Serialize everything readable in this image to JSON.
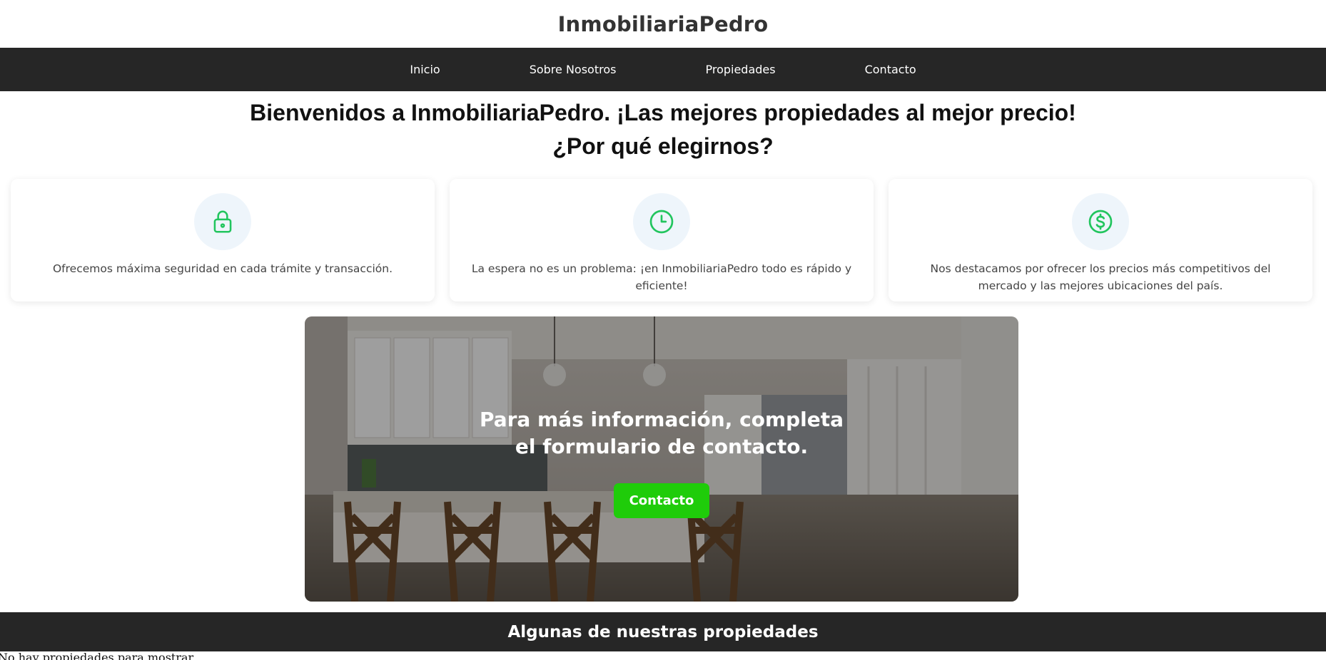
{
  "header": {
    "brand": "InmobiliariaPedro"
  },
  "nav": {
    "items": [
      {
        "label": "Inicio"
      },
      {
        "label": "Sobre Nosotros"
      },
      {
        "label": "Propiedades"
      },
      {
        "label": "Contacto"
      }
    ]
  },
  "hero": {
    "welcome": "Bienvenidos a InmobiliariaPedro. ¡Las mejores propiedades al mejor precio!",
    "why": "¿Por qué elegirnos?"
  },
  "features": [
    {
      "icon": "lock-icon",
      "text": "Ofrecemos máxima seguridad en cada trámite y transacción."
    },
    {
      "icon": "clock-icon",
      "text": "La espera no es un problema: ¡en InmobiliariaPedro todo es rápido y eficiente!"
    },
    {
      "icon": "dollar-icon",
      "text": "Nos destacamos por ofrecer los precios más competitivos del mercado y las mejores ubicaciones del país."
    }
  ],
  "cta": {
    "title": "Para más información, completa el formulario de contacto.",
    "button_label": "Contacto"
  },
  "properties": {
    "title": "Algunas de nuestras propiedades",
    "empty_message": "No hay propiedades para mostrar"
  },
  "colors": {
    "nav_bg": "#262626",
    "accent_green": "#1fcc0a",
    "icon_green": "#22c55e",
    "icon_circle_bg": "#eef5fb"
  }
}
